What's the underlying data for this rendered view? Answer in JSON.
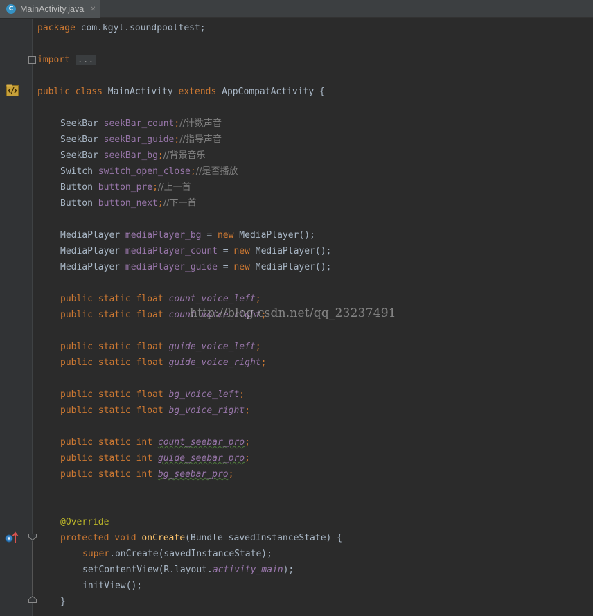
{
  "tab": {
    "icon_letter": "C",
    "label": "MainActivity.java",
    "close": "✕"
  },
  "code": {
    "package_kw": "package",
    "package_name": " com.kgyl.soundpooltest;",
    "import_kw": "import",
    "import_fold": "...",
    "class_decl": {
      "public": "public",
      "class": "class",
      "name": " MainActivity ",
      "extends": "extends",
      "parent": " AppCompatActivity {"
    },
    "fields": [
      {
        "type": "SeekBar ",
        "name": "seekBar_count",
        "comment": "//计数声音"
      },
      {
        "type": "SeekBar ",
        "name": "seekBar_guide",
        "comment": "//指导声音"
      },
      {
        "type": "SeekBar ",
        "name": "seekBar_bg",
        "comment": "//背景音乐"
      },
      {
        "type": "Switch ",
        "name": "switch_open_close",
        "comment": "//是否播放"
      },
      {
        "type": "Button ",
        "name": "button_pre",
        "comment": "//上一首"
      },
      {
        "type": "Button ",
        "name": "button_next",
        "comment": "//下一首"
      }
    ],
    "players": [
      {
        "type": "MediaPlayer ",
        "name": "mediaPlayer_bg",
        "assign": " = ",
        "new": "new",
        "ctor": " MediaPlayer();"
      },
      {
        "type": "MediaPlayer ",
        "name": "mediaPlayer_count",
        "assign": " = ",
        "new": "new",
        "ctor": " MediaPlayer();"
      },
      {
        "type": "MediaPlayer ",
        "name": "mediaPlayer_guide",
        "assign": " = ",
        "new": "new",
        "ctor": " MediaPlayer();"
      }
    ],
    "statics": [
      {
        "mods": "public static float ",
        "name": "count_voice_left"
      },
      {
        "mods": "public static float ",
        "name": "count_voice_right"
      },
      {
        "mods": "public static float ",
        "name": "guide_voice_left"
      },
      {
        "mods": "public static float ",
        "name": "guide_voice_right"
      },
      {
        "mods": "public static float ",
        "name": "bg_voice_left"
      },
      {
        "mods": "public static float ",
        "name": "bg_voice_right"
      },
      {
        "mods": "public static int ",
        "name": "count_seebar_pro"
      },
      {
        "mods": "public static int ",
        "name": "guide_seebar_pro"
      },
      {
        "mods": "public static int ",
        "name": "bg_seebar_pro"
      }
    ],
    "semicolon": ";",
    "override": "@Override",
    "oncreate": {
      "protected": "protected",
      "void": " void ",
      "name": "onCreate",
      "params": "(Bundle savedInstanceState) {"
    },
    "super_kw": "super",
    "super_call": ".onCreate(savedInstanceState);",
    "setcontent_a": "setContentView(R.layout.",
    "setcontent_field": "activity_main",
    "setcontent_b": ");",
    "initview": "initView();",
    "close_brace": "}"
  },
  "watermark": "http://blog.csdn.net/qq_23237491",
  "colors": {
    "background": "#2B2B2B",
    "keyword": "#CC7832",
    "field": "#9876AA",
    "comment": "#808080",
    "annotation": "#BBB529",
    "method": "#FFC66D",
    "text": "#A9B7C6"
  }
}
